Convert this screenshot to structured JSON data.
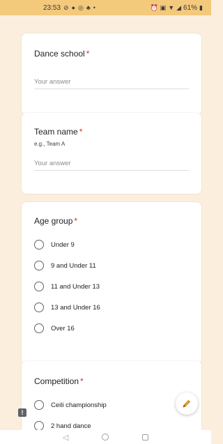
{
  "status_bar": {
    "time": "23:53",
    "battery": "61%"
  },
  "questions": {
    "dance_school": {
      "title": "Dance school",
      "required": "*",
      "answer_placeholder": "Your answer"
    },
    "team_name": {
      "title": "Team name",
      "required": "*",
      "hint": "e.g., Team A",
      "answer_placeholder": "Your answer"
    },
    "age_group": {
      "title": "Age group",
      "required": "*",
      "options": [
        "Under 9",
        "9 and Under 11",
        "11 and Under 13",
        "13 and Under 16",
        "Over 16"
      ]
    },
    "competition": {
      "title": "Competition",
      "required": "*",
      "options": [
        "Ceili championship",
        "2 hand dance"
      ]
    }
  },
  "fab": {
    "icon": "pencil-icon"
  },
  "feedback": {
    "icon": "feedback-icon",
    "glyph": "!"
  },
  "colors": {
    "accent_status_bar": "#f3c97b",
    "page_bg": "#fbeedd",
    "required": "#d93025"
  }
}
